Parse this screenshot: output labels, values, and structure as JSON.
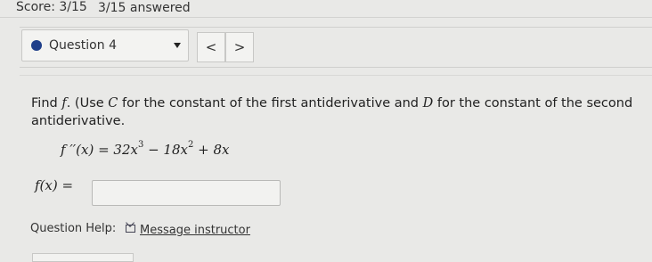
{
  "header": {
    "score": "Score: 3/15",
    "answered": "3/15 answered"
  },
  "question_nav": {
    "selected": "Question 4",
    "prev_label": "<",
    "next_label": ">"
  },
  "problem": {
    "find": "Find",
    "f": "f",
    "use": ". (Use",
    "C": "C",
    "mid": "for the constant of the first antiderivative and",
    "D": "D",
    "end": "for the constant of the second antiderivative.",
    "equation": {
      "lhs": "f ′′(x) = ",
      "t1": "32x",
      "t1_exp": "3",
      "t2": " − 18x",
      "t2_exp": "2",
      "t3": " + 8x"
    },
    "answer_label": "f(x) =",
    "answer_value": ""
  },
  "help": {
    "label": "Question Help:",
    "message_link": "Message instructor",
    "icon": "mail-icon"
  },
  "colors": {
    "background": "#e9e9e7",
    "dot": "#1f3f8a"
  }
}
